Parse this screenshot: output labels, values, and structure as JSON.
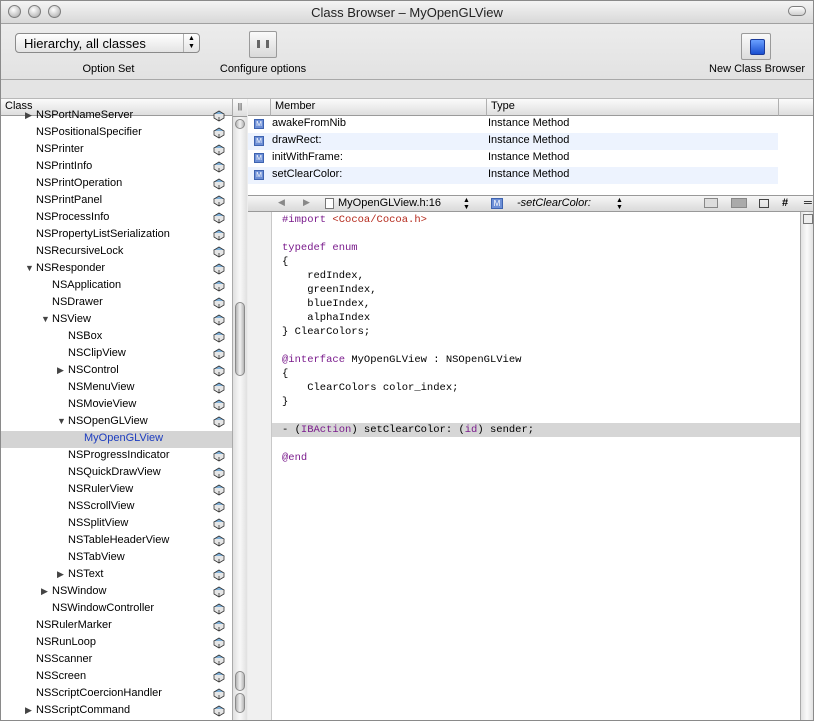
{
  "window": {
    "title": "Class Browser – MyOpenGLView"
  },
  "toolbar": {
    "option_set_value": "Hierarchy, all classes",
    "option_set_label": "Option Set",
    "configure_label": "Configure options",
    "new_browser_label": "New Class Browser"
  },
  "class_pane": {
    "header": "Class",
    "splitter_glyph": "||",
    "items": [
      {
        "label": "NSPortNameServer",
        "tri": "▶"
      },
      {
        "label": "NSPositionalSpecifier",
        "tri": ""
      },
      {
        "label": "NSPrinter",
        "tri": ""
      },
      {
        "label": "NSPrintInfo",
        "tri": ""
      },
      {
        "label": "NSPrintOperation",
        "tri": ""
      },
      {
        "label": "NSPrintPanel",
        "tri": ""
      },
      {
        "label": "NSProcessInfo",
        "tri": ""
      },
      {
        "label": "NSPropertyListSerialization",
        "tri": ""
      },
      {
        "label": "NSRecursiveLock",
        "tri": ""
      },
      {
        "label": "NSResponder",
        "tri": "▼"
      },
      {
        "label": "NSApplication",
        "tri": ""
      },
      {
        "label": "NSDrawer",
        "tri": ""
      },
      {
        "label": "NSView",
        "tri": "▼"
      },
      {
        "label": "NSBox",
        "tri": ""
      },
      {
        "label": "NSClipView",
        "tri": ""
      },
      {
        "label": "NSControl",
        "tri": "▶"
      },
      {
        "label": "NSMenuView",
        "tri": ""
      },
      {
        "label": "NSMovieView",
        "tri": ""
      },
      {
        "label": "NSOpenGLView",
        "tri": "▼"
      },
      {
        "label": "MyOpenGLView",
        "tri": ""
      },
      {
        "label": "NSProgressIndicator",
        "tri": ""
      },
      {
        "label": "NSQuickDrawView",
        "tri": ""
      },
      {
        "label": "NSRulerView",
        "tri": ""
      },
      {
        "label": "NSScrollView",
        "tri": ""
      },
      {
        "label": "NSSplitView",
        "tri": ""
      },
      {
        "label": "NSTableHeaderView",
        "tri": ""
      },
      {
        "label": "NSTabView",
        "tri": ""
      },
      {
        "label": "NSText",
        "tri": "▶"
      },
      {
        "label": "NSWindow",
        "tri": "▶"
      },
      {
        "label": "NSWindowController",
        "tri": ""
      },
      {
        "label": "NSRulerMarker",
        "tri": ""
      },
      {
        "label": "NSRunLoop",
        "tri": ""
      },
      {
        "label": "NSScanner",
        "tri": ""
      },
      {
        "label": "NSScreen",
        "tri": ""
      },
      {
        "label": "NSScriptCoercionHandler",
        "tri": ""
      },
      {
        "label": "NSScriptCommand",
        "tri": "▶"
      }
    ]
  },
  "member_pane": {
    "header_member": "Member",
    "header_type": "Type",
    "rows": [
      {
        "icon": "M",
        "name": "awakeFromNib",
        "type": "Instance Method"
      },
      {
        "icon": "M",
        "name": "drawRect:",
        "type": "Instance Method"
      },
      {
        "icon": "M",
        "name": "initWithFrame:",
        "type": "Instance Method"
      },
      {
        "icon": "M",
        "name": "setClearColor:",
        "type": "Instance Method"
      }
    ]
  },
  "navbar": {
    "back": "◀",
    "forward": "▶",
    "file": "MyOpenGLView.h:16",
    "symbol_icon": "M",
    "symbol": "-setClearColor:",
    "hash": "#"
  },
  "editor": {
    "lines": [
      {
        "kind": "import",
        "a": "#import ",
        "b": "<Cocoa/Cocoa.h>"
      },
      {
        "kind": "blank"
      },
      {
        "kind": "kw",
        "text": "typedef enum"
      },
      {
        "kind": "plain",
        "text": "{"
      },
      {
        "kind": "plain",
        "text": "    redIndex,"
      },
      {
        "kind": "plain",
        "text": "    greenIndex,"
      },
      {
        "kind": "plain",
        "text": "    blueIndex,"
      },
      {
        "kind": "plain",
        "text": "    alphaIndex"
      },
      {
        "kind": "plain",
        "text": "} ClearColors;"
      },
      {
        "kind": "blank"
      },
      {
        "kind": "iface",
        "a": "@interface",
        "b": " MyOpenGLView : NSOpenGLView"
      },
      {
        "kind": "plain",
        "text": "{"
      },
      {
        "kind": "plain",
        "text": "    ClearColors color_index;"
      },
      {
        "kind": "plain",
        "text": "}"
      },
      {
        "kind": "blank"
      },
      {
        "kind": "method",
        "a": "- (",
        "b": "IBAction",
        "c": ") setClearColor: (",
        "d": "id",
        "e": ") sender;"
      },
      {
        "kind": "blank"
      },
      {
        "kind": "kw",
        "text": "@end"
      }
    ]
  }
}
